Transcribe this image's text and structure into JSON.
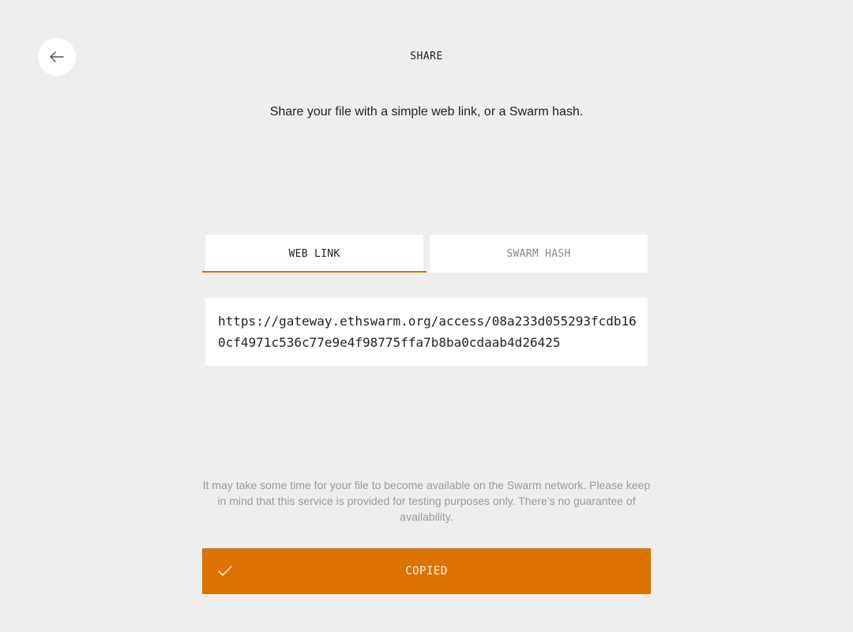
{
  "header": {
    "back_icon": "arrow-left-icon",
    "title": "SHARE"
  },
  "intro": {
    "text": "Share your file with a simple web link, or a Swarm hash."
  },
  "tabs": [
    {
      "label": "WEB LINK",
      "active": true
    },
    {
      "label": "SWARM HASH",
      "active": false
    }
  ],
  "link": {
    "value": "https://gateway.ethswarm.org/access/08a233d055293fcdb160cf4971c536c77e9e4f98775ffa7b8ba0cdaab4d26425"
  },
  "disclaimer": {
    "text": "It may take some time for your file to become available on the Swarm network. Please keep in mind that this service is provided for testing purposes only. There’s no guarantee of availability."
  },
  "copy_button": {
    "label": "COPIED",
    "icon": "check-icon"
  },
  "colors": {
    "accent": "#dd7200",
    "background": "#eeeeee",
    "surface": "#ffffff"
  }
}
